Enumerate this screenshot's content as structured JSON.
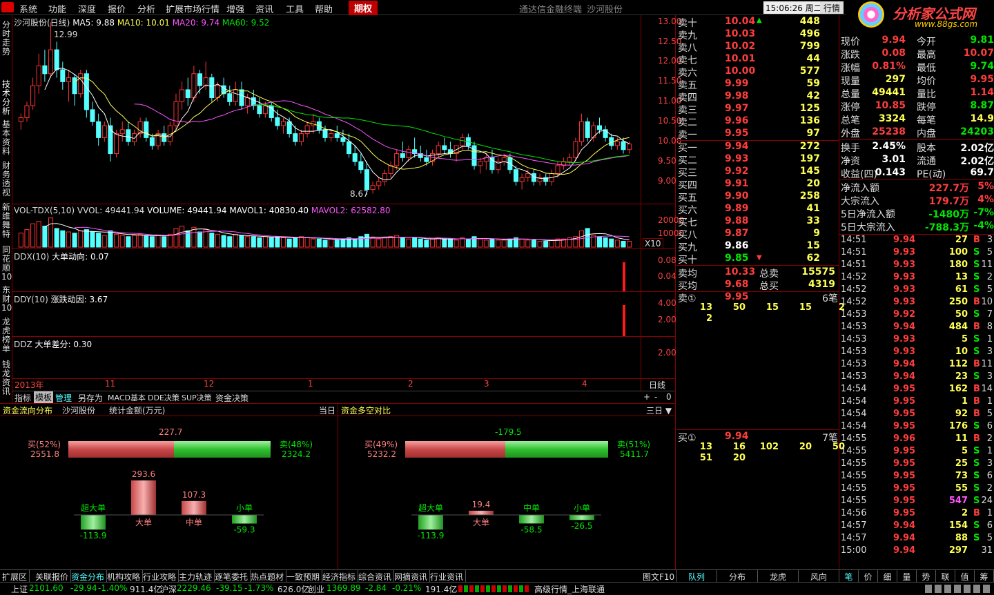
{
  "menu": [
    "系统",
    "功能",
    "深度",
    "报价",
    "分析",
    "扩展市场行情",
    "增强",
    "资讯",
    "工具",
    "帮助"
  ],
  "menu_highlight": "期权",
  "window_title": "通达信金融终端",
  "stock_title": "沙河股份",
  "clock": "15:06:26",
  "weekday": "周二",
  "quote_btn": "行情",
  "logo_text": "分析家公式网",
  "logo_url": "www.88gs.com",
  "left_tabs": [
    "分时走势",
    "技术分析",
    "基本资料",
    "财务透视",
    "新维舞特",
    "同花顺10",
    "东财10",
    "龙虎榜单",
    "钱龙资讯"
  ],
  "chart_title": "沙河股份(日线)",
  "ma": {
    "ma5": "MA5: 9.88",
    "ma10": "MA10: 10.01",
    "ma20": "MA20: 9.74",
    "ma60": "MA60: 9.52"
  },
  "price_high_label": "12.99",
  "price_low_label": "8.67",
  "price_ticks": [
    "13.00",
    "12.50",
    "12.00",
    "11.50",
    "11.00",
    "10.50",
    "10.00",
    "9.50",
    "9.00"
  ],
  "vol": {
    "name": "VOL-TDX(5,10)",
    "vvol": "VVOL: 49441.94",
    "volume": "VOLUME: 49441.94",
    "mavol1": "MAVOL1: 40830.40",
    "mavol2": "MAVOL2: 62582.80",
    "ticks": [
      "20000",
      "10000"
    ],
    "unit": "X10"
  },
  "ddx": {
    "label": "DDX(10)",
    "name": "大单动向: 0.07",
    "ticks": [
      "0.08",
      "0.04"
    ]
  },
  "ddy": {
    "label": "DDY(10)",
    "name": "涨跌动因: 3.67",
    "ticks": [
      "4.00",
      "2.00"
    ]
  },
  "ddz": {
    "label": "DDZ",
    "name": "大单差分: 0.30",
    "ticks": [
      "2.00"
    ]
  },
  "x_axis": [
    "2013年",
    "11",
    "12",
    "1",
    "2",
    "3",
    "4"
  ],
  "period": "日线",
  "tools": [
    "指标",
    "模板",
    "管理",
    "另存为",
    "MACD基本",
    "DDE决策",
    "SUP决策",
    "资金决策"
  ],
  "scroll_ctrl": [
    "+",
    "-",
    "0"
  ],
  "orderbook": {
    "asks": [
      [
        "卖十",
        "10.04",
        "448"
      ],
      [
        "卖九",
        "10.03",
        "496"
      ],
      [
        "卖八",
        "10.02",
        "799"
      ],
      [
        "卖七",
        "10.01",
        "44"
      ],
      [
        "卖六",
        "10.00",
        "577"
      ],
      [
        "卖五",
        "9.99",
        "59"
      ],
      [
        "卖四",
        "9.98",
        "42"
      ],
      [
        "卖三",
        "9.97",
        "125"
      ],
      [
        "卖二",
        "9.96",
        "136"
      ],
      [
        "卖一",
        "9.95",
        "97"
      ]
    ],
    "bids": [
      [
        "买一",
        "9.94",
        "272"
      ],
      [
        "买二",
        "9.93",
        "197"
      ],
      [
        "买三",
        "9.92",
        "145"
      ],
      [
        "买四",
        "9.91",
        "20"
      ],
      [
        "买五",
        "9.90",
        "258"
      ],
      [
        "买六",
        "9.89",
        "41"
      ],
      [
        "买七",
        "9.88",
        "33"
      ],
      [
        "买八",
        "9.87",
        "9"
      ],
      [
        "买九",
        "9.86",
        "15"
      ],
      [
        "买十",
        "9.85",
        "62"
      ]
    ],
    "avg": [
      [
        "卖均",
        "10.33",
        "总卖",
        "15575"
      ],
      [
        "买均",
        "9.68",
        "总买",
        "4319"
      ]
    ],
    "sell1": {
      "label": "卖①",
      "price": "9.95",
      "count": "6笔",
      "q1": [
        "13",
        "50",
        "15",
        "15",
        "2"
      ],
      "q2": [
        "2"
      ]
    },
    "buy1": {
      "label": "买①",
      "price": "9.94",
      "count": "7笔",
      "q1": [
        "13",
        "16",
        "102",
        "20",
        "50"
      ],
      "q2": [
        "51",
        "20"
      ]
    }
  },
  "quote": [
    [
      "现价",
      "9.94",
      "今开",
      "9.81"
    ],
    [
      "涨跌",
      "0.08",
      "最高",
      "10.07"
    ],
    [
      "涨幅",
      "0.81%",
      "最低",
      "9.74"
    ],
    [
      "现量",
      "297",
      "均价",
      "9.95"
    ],
    [
      "总量",
      "49441",
      "量比",
      "1.14"
    ],
    [
      "涨停",
      "10.85",
      "跌停",
      "8.87"
    ],
    [
      "总笔",
      "3324",
      "每笔",
      "14.9"
    ],
    [
      "外盘",
      "25238",
      "内盘",
      "24203"
    ]
  ],
  "quote2": [
    [
      "换手",
      "2.45%",
      "股本",
      "2.02亿"
    ],
    [
      "净资",
      "3.01",
      "流通",
      "2.02亿"
    ],
    [
      "收益(四)",
      "0.143",
      "PE(动)",
      "69.7"
    ]
  ],
  "flows": [
    [
      "净流入额",
      "227.7万",
      "5%"
    ],
    [
      "大宗流入",
      "179.7万",
      "4%"
    ],
    [
      "5日净流入额",
      "-1480万",
      "-7%"
    ],
    [
      "5日大宗流入",
      "-788.3万",
      "-4%"
    ]
  ],
  "ticks": [
    [
      "14:51",
      "9.94",
      "27",
      "B",
      "3"
    ],
    [
      "14:51",
      "9.93",
      "100",
      "S",
      "5"
    ],
    [
      "14:51",
      "9.93",
      "180",
      "S",
      "11"
    ],
    [
      "14:52",
      "9.93",
      "13",
      "S",
      "2"
    ],
    [
      "14:52",
      "9.93",
      "61",
      "S",
      "5"
    ],
    [
      "14:52",
      "9.93",
      "250",
      "B",
      "10"
    ],
    [
      "14:53",
      "9.92",
      "50",
      "S",
      "7"
    ],
    [
      "14:53",
      "9.94",
      "484",
      "B",
      "8"
    ],
    [
      "14:53",
      "9.93",
      "5",
      "S",
      "1"
    ],
    [
      "14:53",
      "9.93",
      "10",
      "S",
      "3"
    ],
    [
      "14:53",
      "9.94",
      "112",
      "B",
      "11"
    ],
    [
      "14:53",
      "9.94",
      "23",
      "S",
      "3"
    ],
    [
      "14:54",
      "9.95",
      "162",
      "B",
      "14"
    ],
    [
      "14:54",
      "9.95",
      "1",
      "B",
      "1"
    ],
    [
      "14:54",
      "9.95",
      "92",
      "B",
      "5"
    ],
    [
      "14:54",
      "9.95",
      "176",
      "S",
      "6"
    ],
    [
      "14:55",
      "9.96",
      "11",
      "B",
      "2"
    ],
    [
      "14:55",
      "9.95",
      "5",
      "S",
      "1"
    ],
    [
      "14:55",
      "9.95",
      "25",
      "S",
      "3"
    ],
    [
      "14:55",
      "9.95",
      "73",
      "S",
      "6"
    ],
    [
      "14:55",
      "9.95",
      "55",
      "S",
      "2"
    ],
    [
      "14:55",
      "9.95",
      "547",
      "S",
      "24"
    ],
    [
      "14:56",
      "9.95",
      "2",
      "B",
      "1"
    ],
    [
      "14:57",
      "9.94",
      "154",
      "S",
      "6"
    ],
    [
      "14:57",
      "9.94",
      "88",
      "S",
      "5"
    ],
    [
      "15:00",
      "9.94",
      "297",
      "",
      "31"
    ]
  ],
  "fund_dist": {
    "title": "资金流向分布",
    "stock": "沙河股份",
    "unit": "统计金额(万元)",
    "period": "当日",
    "net": "227.7",
    "buy_pct": "买(52%)",
    "buy_amt": "2551.8",
    "sell_pct": "卖(48%)",
    "sell_amt": "2324.2",
    "cats": [
      {
        "name": "超大单",
        "value": -113.9,
        "label": "-113.9"
      },
      {
        "name": "大单",
        "value": 293.6,
        "label": "293.6"
      },
      {
        "name": "中单",
        "value": 107.3,
        "label": "107.3"
      },
      {
        "name": "小单",
        "value": -59.3,
        "label": "-59.3"
      }
    ]
  },
  "fund_cmp": {
    "title": "资金多空对比",
    "period": "三日",
    "net": "-179.5",
    "buy_pct": "买(49%)",
    "buy_amt": "5232.2",
    "sell_pct": "卖(51%)",
    "sell_amt": "5411.7",
    "cats": [
      {
        "name": "超大单",
        "value": -113.9,
        "label": "-113.9"
      },
      {
        "name": "大单",
        "value": 19.4,
        "label": "19.4"
      },
      {
        "name": "中单",
        "value": -58.5,
        "label": "-58.5"
      },
      {
        "name": "小单",
        "value": -26.5,
        "label": "-26.5"
      }
    ]
  },
  "bottom_tabs": [
    "扩展区",
    "关联报价",
    "资金分布",
    "机构攻略",
    "行业攻略",
    "主力轨迹",
    "逐笔委托",
    "热点题材",
    "一致预期",
    "经济指标",
    "综合资讯",
    "网摘资讯",
    "行业资讯"
  ],
  "bottom_right": "图文F10",
  "ob_tabs": [
    "队列",
    "分布",
    "龙虎",
    "风向"
  ],
  "tick_tabs": [
    "笔",
    "价",
    "细",
    "量",
    "势",
    "联",
    "值",
    "筹"
  ],
  "status": {
    "sh": [
      "上证",
      "2101.60",
      "-29.94",
      "-1.40%",
      "911.4亿"
    ],
    "sz": [
      "沪深",
      "2229.46",
      "-39.15",
      "-1.73%",
      "626.0亿"
    ],
    "cy": [
      "创业",
      "1369.89",
      "-2.84",
      "-0.21%",
      "191.4亿"
    ],
    "feed": "高级行情_上海联通"
  },
  "candles": [
    [
      10.5,
      10.7,
      10.3,
      10.6
    ],
    [
      10.6,
      11.0,
      10.5,
      10.9
    ],
    [
      10.9,
      11.6,
      10.8,
      11.4
    ],
    [
      11.4,
      12.2,
      11.2,
      11.9
    ],
    [
      11.9,
      12.3,
      11.5,
      11.7
    ],
    [
      11.7,
      12.99,
      11.6,
      12.3
    ],
    [
      12.3,
      12.5,
      11.6,
      11.8
    ],
    [
      11.8,
      12.0,
      11.3,
      11.5
    ],
    [
      11.5,
      11.8,
      11.0,
      11.6
    ],
    [
      11.6,
      11.7,
      10.9,
      11.2
    ],
    [
      11.2,
      11.8,
      11.1,
      11.7
    ],
    [
      11.7,
      11.8,
      10.6,
      10.8
    ],
    [
      10.8,
      11.0,
      10.4,
      10.5
    ],
    [
      10.5,
      10.7,
      9.9,
      10.1
    ],
    [
      10.1,
      10.5,
      10.0,
      10.4
    ],
    [
      10.4,
      10.6,
      9.5,
      9.7
    ],
    [
      9.7,
      10.3,
      9.6,
      10.2
    ],
    [
      10.2,
      10.5,
      10.0,
      10.3
    ],
    [
      10.3,
      10.5,
      9.9,
      10.0
    ],
    [
      10.0,
      10.3,
      9.9,
      10.2
    ],
    [
      10.2,
      10.6,
      10.1,
      10.5
    ],
    [
      10.5,
      10.6,
      10.0,
      10.1
    ],
    [
      10.1,
      10.2,
      9.8,
      9.9
    ],
    [
      9.9,
      10.3,
      9.8,
      10.2
    ],
    [
      10.2,
      10.4,
      9.9,
      10.0
    ],
    [
      10.0,
      10.5,
      9.9,
      10.4
    ],
    [
      10.4,
      11.2,
      10.3,
      11.0
    ],
    [
      11.0,
      11.5,
      10.8,
      11.3
    ],
    [
      11.3,
      11.6,
      10.9,
      11.1
    ],
    [
      11.1,
      11.9,
      11.0,
      11.7
    ],
    [
      11.7,
      11.8,
      11.2,
      11.4
    ],
    [
      11.4,
      12.0,
      11.3,
      11.6
    ],
    [
      11.6,
      11.7,
      11.0,
      11.1
    ],
    [
      11.1,
      11.5,
      11.0,
      11.4
    ],
    [
      11.4,
      11.6,
      11.1,
      11.2
    ],
    [
      11.2,
      11.4,
      10.9,
      11.0
    ],
    [
      11.0,
      11.5,
      10.9,
      11.3
    ],
    [
      11.3,
      11.5,
      10.8,
      10.9
    ],
    [
      10.9,
      11.2,
      10.7,
      11.1
    ],
    [
      11.1,
      11.3,
      10.8,
      10.9
    ],
    [
      10.9,
      11.1,
      10.6,
      10.7
    ],
    [
      10.7,
      11.0,
      10.6,
      10.9
    ],
    [
      10.9,
      11.0,
      10.5,
      10.6
    ],
    [
      10.6,
      10.8,
      10.3,
      10.4
    ],
    [
      10.4,
      10.6,
      10.2,
      10.5
    ],
    [
      10.5,
      10.6,
      10.1,
      10.2
    ],
    [
      10.2,
      10.4,
      9.9,
      10.0
    ],
    [
      10.0,
      10.3,
      9.9,
      10.2
    ],
    [
      10.2,
      10.5,
      10.1,
      10.4
    ],
    [
      10.4,
      10.7,
      10.2,
      10.5
    ],
    [
      10.5,
      10.6,
      10.2,
      10.3
    ],
    [
      10.3,
      10.4,
      10.0,
      10.1
    ],
    [
      10.1,
      10.3,
      10.0,
      10.2
    ],
    [
      10.2,
      10.4,
      10.0,
      10.1
    ],
    [
      10.1,
      10.3,
      9.9,
      10.0
    ],
    [
      10.0,
      10.2,
      9.6,
      9.7
    ],
    [
      9.7,
      9.9,
      9.4,
      9.5
    ],
    [
      9.5,
      9.7,
      9.2,
      9.3
    ],
    [
      9.3,
      9.5,
      8.67,
      8.8
    ],
    [
      8.8,
      9.0,
      8.7,
      8.9
    ],
    [
      8.9,
      9.1,
      8.8,
      9.0
    ],
    [
      9.0,
      9.3,
      8.9,
      9.2
    ],
    [
      9.2,
      9.5,
      9.1,
      9.4
    ],
    [
      9.4,
      9.8,
      9.3,
      9.7
    ],
    [
      9.7,
      10.0,
      9.5,
      9.6
    ],
    [
      9.6,
      9.9,
      9.5,
      9.8
    ],
    [
      9.8,
      10.1,
      9.6,
      9.7
    ],
    [
      9.7,
      9.9,
      9.5,
      9.6
    ],
    [
      9.6,
      9.8,
      9.4,
      9.5
    ],
    [
      9.5,
      9.8,
      9.4,
      9.7
    ],
    [
      9.7,
      10.0,
      9.6,
      9.9
    ],
    [
      9.9,
      10.1,
      9.7,
      9.8
    ],
    [
      9.8,
      10.0,
      9.6,
      9.7
    ],
    [
      9.7,
      9.9,
      9.5,
      9.9
    ],
    [
      9.9,
      10.2,
      9.8,
      10.1
    ],
    [
      10.1,
      10.2,
      9.8,
      9.9
    ],
    [
      9.9,
      10.0,
      9.3,
      9.4
    ],
    [
      9.4,
      9.6,
      9.2,
      9.5
    ],
    [
      9.5,
      9.7,
      9.3,
      9.6
    ],
    [
      9.6,
      9.8,
      9.2,
      9.3
    ],
    [
      9.3,
      9.6,
      9.2,
      9.5
    ],
    [
      9.5,
      9.7,
      9.4,
      9.6
    ],
    [
      9.6,
      9.7,
      9.2,
      9.3
    ],
    [
      9.3,
      9.4,
      8.9,
      9.0
    ],
    [
      9.0,
      9.2,
      8.8,
      9.1
    ],
    [
      9.1,
      9.3,
      9.0,
      9.2
    ],
    [
      9.2,
      9.3,
      8.9,
      9.0
    ],
    [
      9.0,
      9.2,
      8.9,
      9.1
    ],
    [
      9.1,
      9.2,
      8.9,
      9.0
    ],
    [
      9.0,
      9.3,
      8.9,
      9.2
    ],
    [
      9.2,
      9.5,
      9.1,
      9.4
    ],
    [
      9.4,
      9.6,
      9.3,
      9.5
    ],
    [
      9.5,
      9.7,
      9.4,
      9.6
    ],
    [
      9.6,
      10.1,
      9.5,
      10.0
    ],
    [
      10.0,
      10.7,
      9.9,
      10.5
    ],
    [
      10.5,
      10.6,
      10.0,
      10.1
    ],
    [
      10.1,
      10.5,
      10.0,
      10.4
    ],
    [
      10.4,
      10.6,
      10.2,
      10.3
    ],
    [
      10.3,
      10.4,
      10.0,
      10.1
    ],
    [
      10.1,
      10.2,
      9.8,
      9.9
    ],
    [
      9.9,
      10.1,
      9.8,
      10.0
    ],
    [
      10.0,
      10.1,
      9.7,
      9.8
    ],
    [
      9.8,
      10.0,
      9.7,
      9.94
    ]
  ],
  "volumes": [
    12,
    15,
    20,
    22,
    18,
    25,
    16,
    14,
    13,
    12,
    14,
    15,
    13,
    12,
    10,
    14,
    11,
    10,
    9,
    10,
    11,
    10,
    9,
    10,
    9,
    11,
    16,
    18,
    14,
    17,
    13,
    15,
    12,
    11,
    10,
    9,
    11,
    10,
    9,
    9,
    8,
    9,
    8,
    9,
    8,
    7,
    8,
    9,
    8,
    7,
    7,
    6,
    7,
    6,
    7,
    8,
    7,
    9,
    11,
    8,
    7,
    8,
    9,
    10,
    8,
    7,
    8,
    7,
    6,
    7,
    8,
    7,
    7,
    6,
    8,
    7,
    9,
    7,
    6,
    7,
    6,
    6,
    7,
    8,
    7,
    6,
    6,
    5,
    5,
    6,
    7,
    7,
    8,
    9,
    14,
    16,
    10,
    9,
    8,
    7,
    6,
    5,
    5
  ]
}
